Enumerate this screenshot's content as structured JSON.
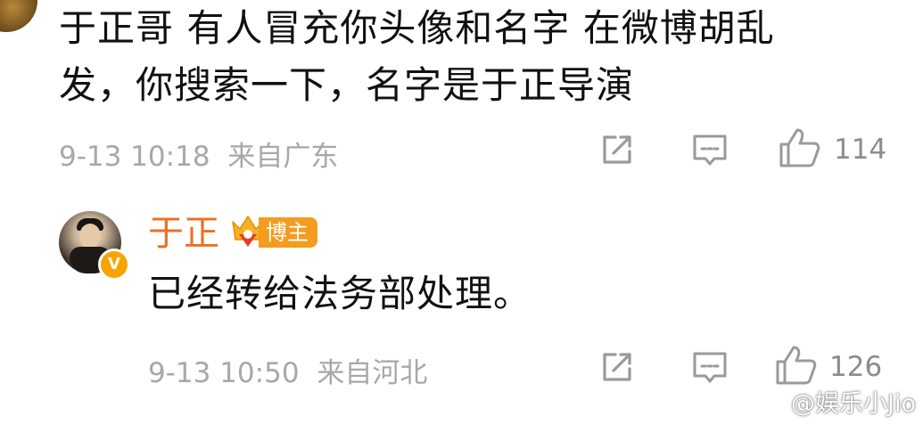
{
  "comment": {
    "text_line1": "于正哥 有人冒充你头像和名字 在微博胡乱",
    "text_line2": "发，你搜索一下，名字是于正导演",
    "timestamp": "9-13 10:18",
    "location": "来自广东",
    "like_count": "114"
  },
  "reply": {
    "username": "于正",
    "badge_label": "博主",
    "verified_mark": "V",
    "text": "已经转给法务部处理。",
    "timestamp": "9-13 10:50",
    "location": "来自河北",
    "like_count": "126"
  },
  "watermark": {
    "text": "@娱乐小Jio"
  },
  "colors": {
    "username": "#eb7123",
    "badge": "#f39c1f",
    "verified": "#f7a400",
    "meta": "#a8a8a8",
    "icon": "#9a9a9a"
  },
  "icons": [
    "share-icon",
    "comment-icon",
    "like-icon",
    "crown-icon",
    "verified-icon",
    "weibo-logo-icon"
  ]
}
